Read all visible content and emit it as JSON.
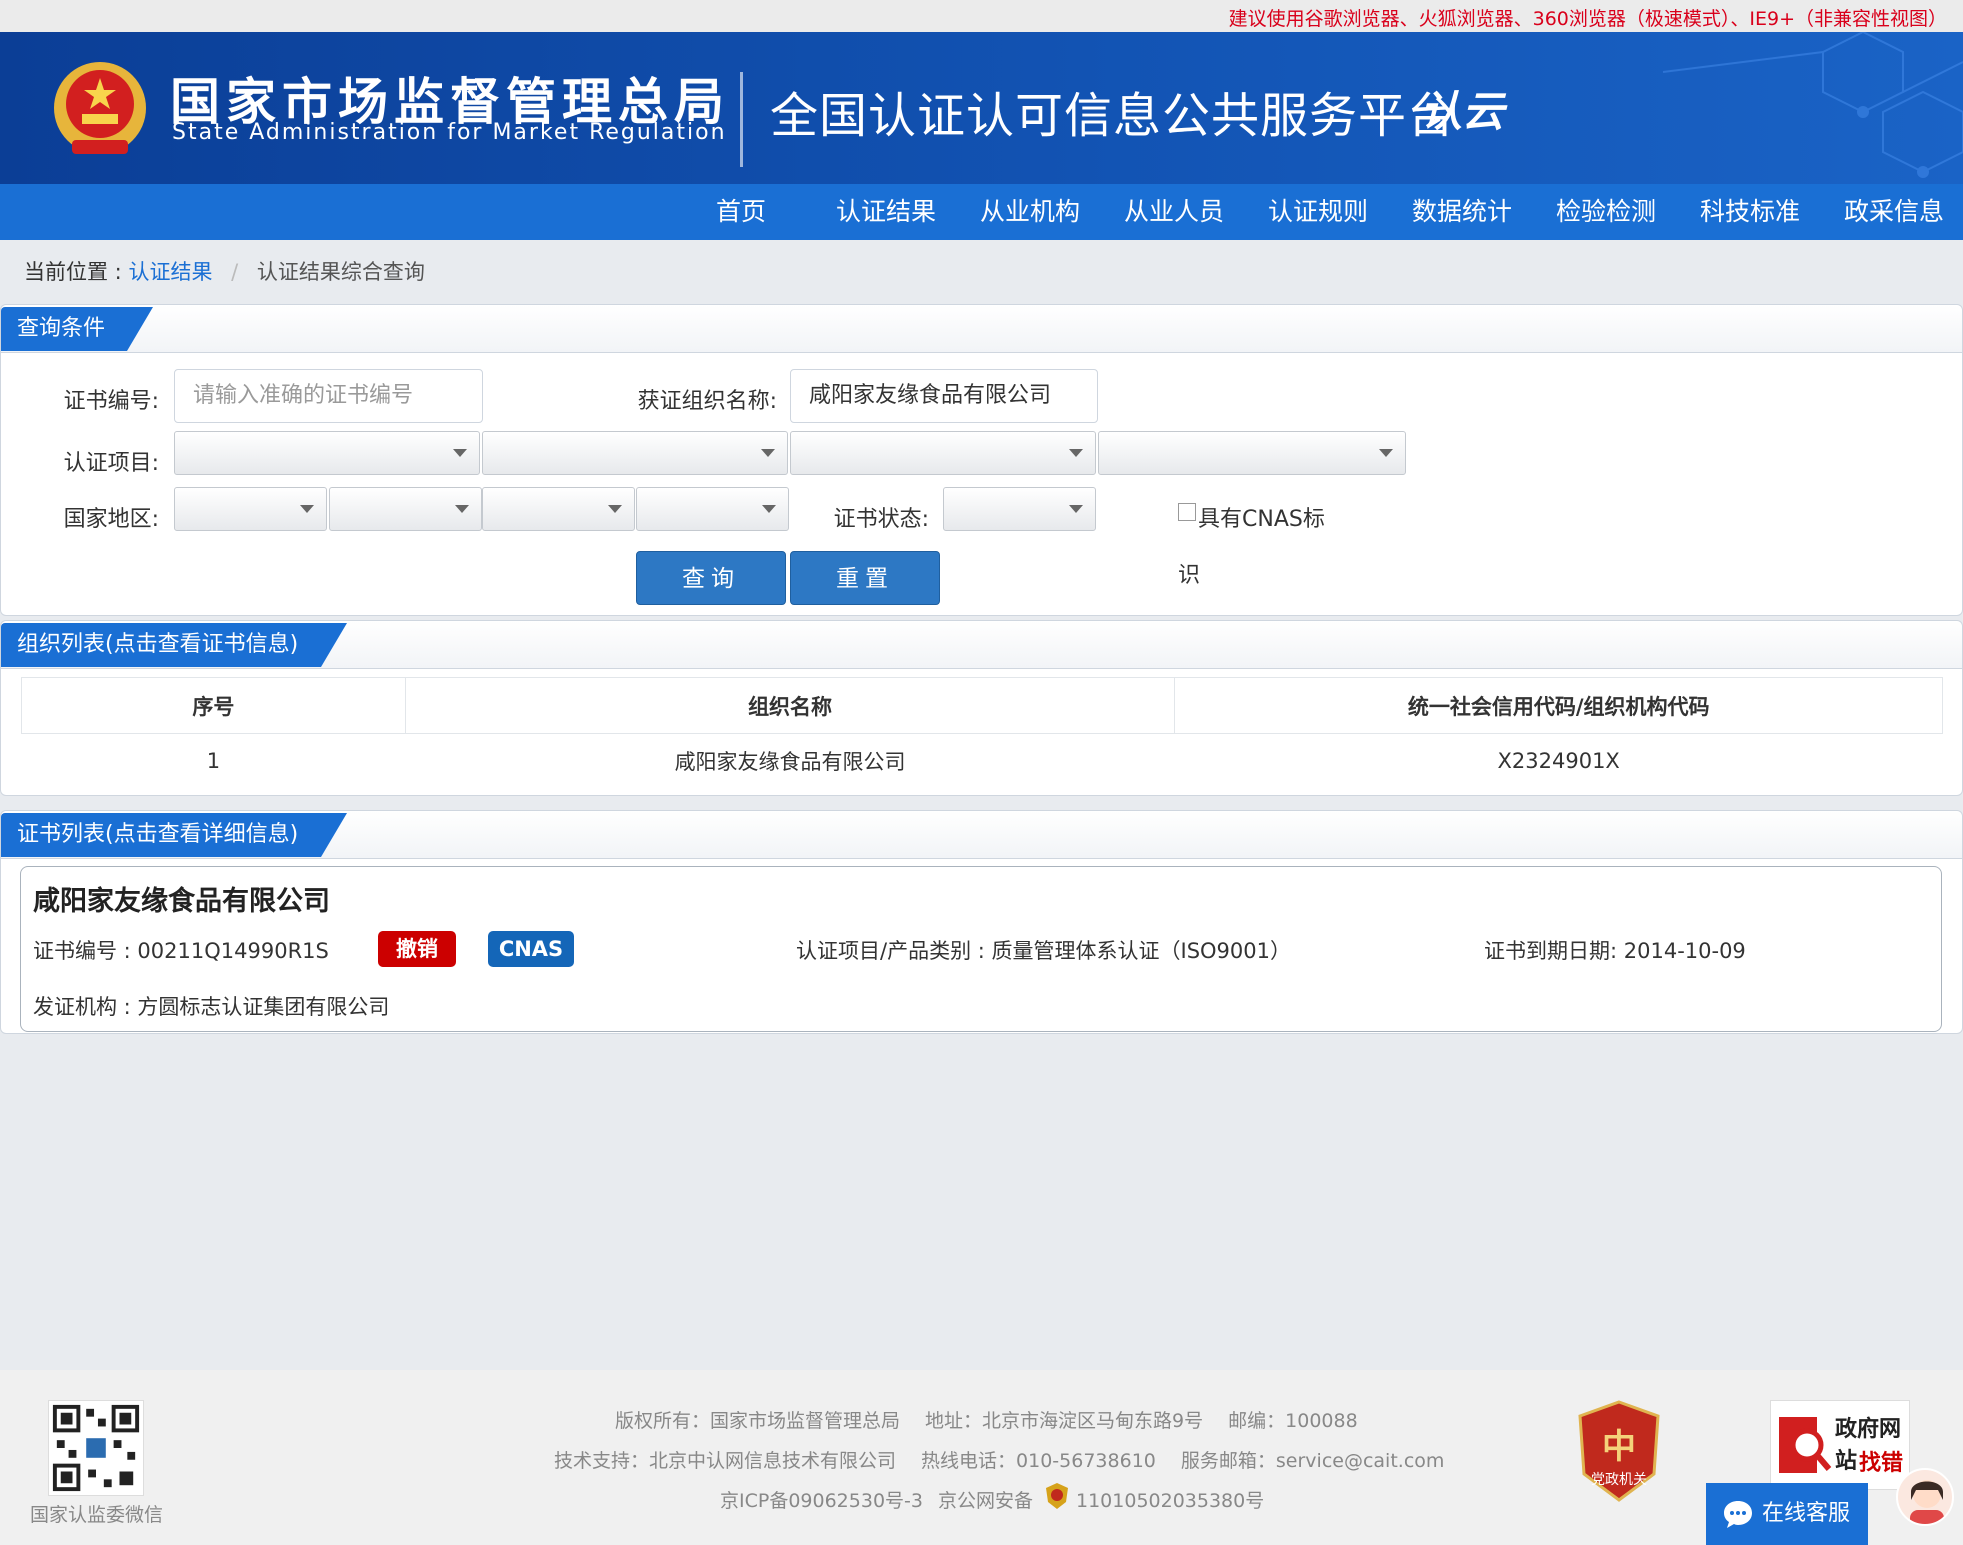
{
  "notice": "建议使用谷歌浏览器、火狐浏览器、360浏览器（极速模式）、IE9+（非兼容性视图）",
  "header": {
    "org_cn": "国家市场监督管理总局",
    "org_en": "State Administration for Market Regulation",
    "platform": "全国认证认可信息公共服务平台",
    "logo_text": "认云"
  },
  "nav": [
    "首页",
    "认证结果",
    "从业机构",
    "从业人员",
    "认证规则",
    "数据统计",
    "检验检测",
    "科技标准",
    "政采信息"
  ],
  "breadcrumb": {
    "prefix": "当前位置 :",
    "link": "认证结果",
    "current": "认证结果综合查询"
  },
  "query": {
    "tab": "查询条件",
    "cert_no_label": "证书编号:",
    "cert_no_placeholder": "请输入准确的证书编号",
    "org_label": "获证组织名称:",
    "org_value": "咸阳家友缘食品有限公司",
    "project_label": "认证项目:",
    "region_label": "国家地区:",
    "status_label": "证书状态:",
    "cnas_label_1": "具有CNAS标",
    "cnas_label_2": "识",
    "search_btn": "查询",
    "reset_btn": "重置"
  },
  "org_list": {
    "tab": "组织列表(点击查看证书信息)",
    "columns": [
      "序号",
      "组织名称",
      "统一社会信用代码/组织机构代码"
    ],
    "rows": [
      [
        "1",
        "咸阳家友缘食品有限公司",
        "X2324901X"
      ]
    ]
  },
  "cert_list": {
    "tab": "证书列表(点击查看详细信息)",
    "card": {
      "org": "咸阳家友缘食品有限公司",
      "cert_no": "证书编号 : 00211Q14990R1S",
      "status_badge": "撤销",
      "cnas_badge": "CNAS",
      "project": "认证项目/产品类别 : 质量管理体系认证（ISO9001）",
      "expiry": "证书到期日期: 2014-10-09",
      "issuer": "发证机构 : 方圆标志认证集团有限公司"
    },
    "colors": {
      "revoked": "#cc0000",
      "cnas": "#1466b8"
    }
  },
  "footer": {
    "line1": "版权所有：国家市场监督管理总局　 地址：北京市海淀区马甸东路9号　 邮编：100088",
    "line2": "技术支持：北京中认网信息技术有限公司　 热线电话：010-56738610　 服务邮箱：service@cait.com",
    "icp": "京ICP备09062530号-3",
    "police": "京公网安备",
    "police_no": "11010502035380号",
    "qr_caption": "国家认监委微信",
    "party_label": "党政机关",
    "gov_t1": "政府网站",
    "gov_t2": "找错",
    "service": "在线客服"
  },
  "accent": "#1a6fd4"
}
